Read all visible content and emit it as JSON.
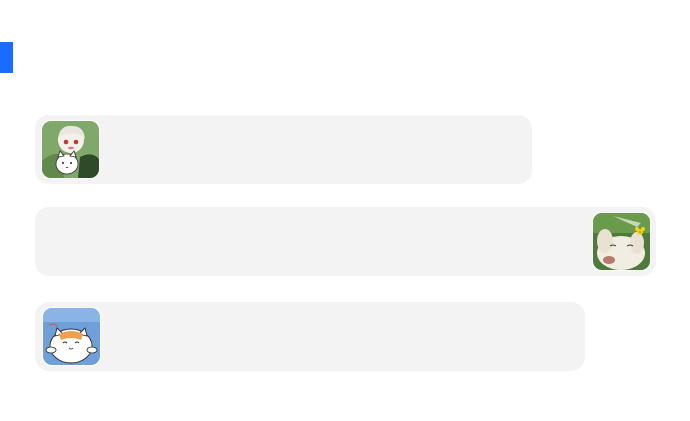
{
  "accent_color": "#1a6cff",
  "bubble_color": "#f3f3f3",
  "messages": [
    {
      "sender": "left",
      "avatar": "illustrated-boy-with-cat-avatar",
      "text": ""
    },
    {
      "sender": "right",
      "avatar": "white-dog-with-flower-avatar",
      "text": ""
    },
    {
      "sender": "left",
      "avatar": "cartoon-cat-blue-sky-avatar",
      "text": ""
    }
  ]
}
